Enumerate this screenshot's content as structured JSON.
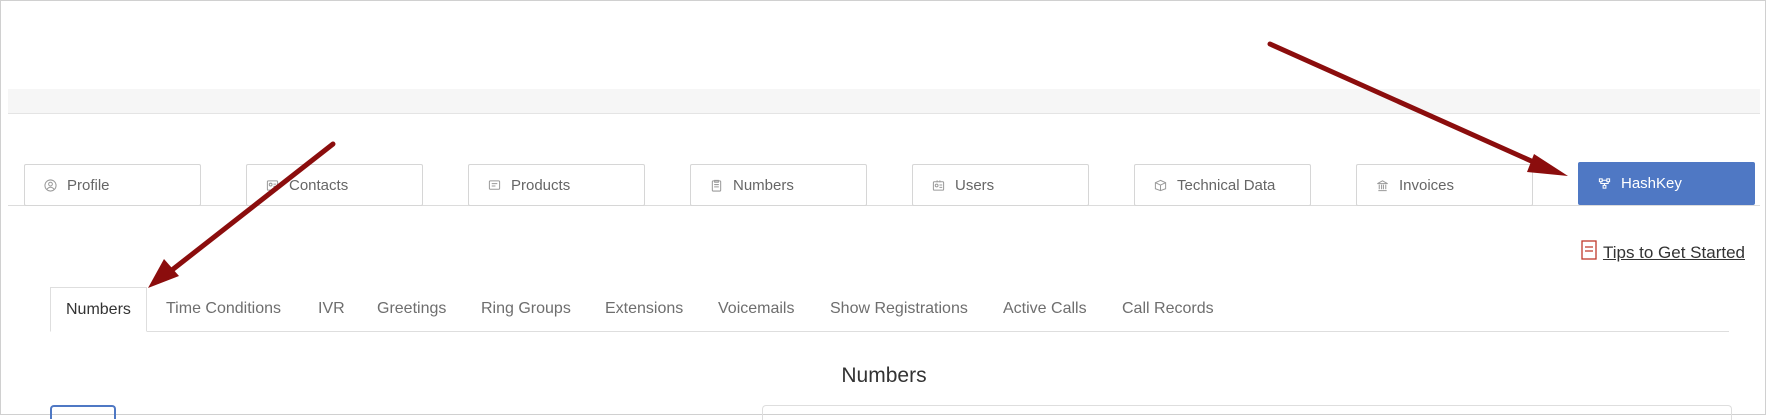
{
  "main_tabs": [
    {
      "label": "Profile",
      "icon": "user-circle-icon"
    },
    {
      "label": "Contacts",
      "icon": "contacts-icon"
    },
    {
      "label": "Products",
      "icon": "products-icon"
    },
    {
      "label": "Numbers",
      "icon": "clipboard-icon"
    },
    {
      "label": "Users",
      "icon": "users-card-icon"
    },
    {
      "label": "Technical Data",
      "icon": "box-icon"
    },
    {
      "label": "Invoices",
      "icon": "bank-icon"
    },
    {
      "label": "HashKey",
      "icon": "network-icon",
      "active": true
    }
  ],
  "tips": {
    "label": "Tips to Get Started",
    "icon": "document-icon"
  },
  "sub_tabs": [
    {
      "label": "Numbers",
      "active": true
    },
    {
      "label": "Time Conditions"
    },
    {
      "label": "IVR"
    },
    {
      "label": "Greetings"
    },
    {
      "label": "Ring Groups"
    },
    {
      "label": "Extensions"
    },
    {
      "label": "Voicemails"
    },
    {
      "label": "Show Registrations"
    },
    {
      "label": "Active Calls"
    },
    {
      "label": "Call Records"
    }
  ],
  "section": {
    "title": "Numbers"
  },
  "colors": {
    "accent": "#4f78c4",
    "annotation_arrow": "#8b0d0d",
    "tips_icon": "#c0392b"
  }
}
